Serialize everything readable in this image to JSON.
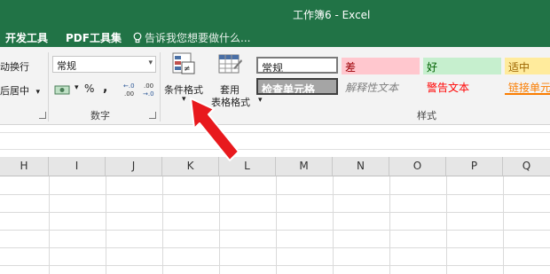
{
  "window": {
    "title": "工作簿6 - Excel"
  },
  "tabs": [
    {
      "label": "开发工具"
    },
    {
      "label": "PDF工具集"
    }
  ],
  "tell_me": {
    "text": "告诉我您想要做什么..."
  },
  "alignment": {
    "wrap_text": "动换行",
    "merge_center": "后居中",
    "merge_dropdown": "▾"
  },
  "number": {
    "format_value": "常规",
    "currency_symbol": "￥",
    "percent": "%",
    "comma": ",",
    "increase_decimal": "←.0\n.00",
    "decrease_decimal": ".00\n→.0",
    "group_label": "数字"
  },
  "conditional_format": {
    "label": "条件格式",
    "dropdown": "▾"
  },
  "format_table": {
    "label_line1": "套用",
    "label_line2": "表格格式",
    "dropdown": "▾"
  },
  "styles": {
    "group_label": "样式",
    "cells": [
      {
        "label": "常规",
        "bg": "#ffffff",
        "color": "#000000"
      },
      {
        "label": "差",
        "bg": "#ffc7ce",
        "color": "#9c0006"
      },
      {
        "label": "好",
        "bg": "#c6efce",
        "color": "#006100"
      },
      {
        "label": "适中",
        "bg": "#ffeb9c",
        "color": "#9c6500"
      },
      {
        "label": "检查单元格",
        "bg": "#a5a5a5",
        "color": "#ffffff"
      },
      {
        "label": "解释性文本",
        "bg": "#f3f3f3",
        "color": "#7f7f7f"
      },
      {
        "label": "警告文本",
        "bg": "#f3f3f3",
        "color": "#ff0000"
      },
      {
        "label": "链接单元格",
        "bg": "#f3f3f3",
        "color": "#fa7d00"
      }
    ]
  },
  "columns": [
    "H",
    "I",
    "J",
    "K",
    "L",
    "M",
    "N",
    "O",
    "P",
    "Q"
  ],
  "colors": {
    "accent": "#217346",
    "annotation_arrow": "#e8191d"
  }
}
